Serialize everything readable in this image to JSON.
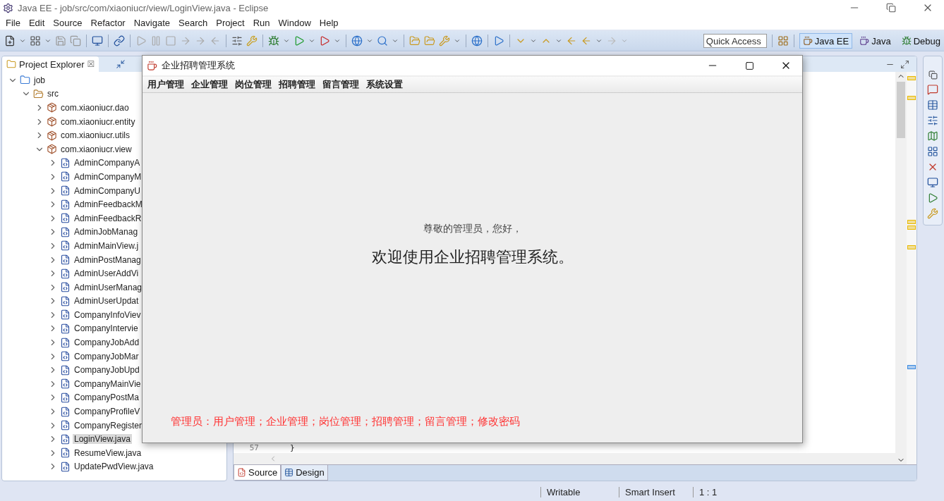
{
  "window": {
    "title": "Java EE - job/src/com/xiaoniucr/view/LoginView.java - Eclipse"
  },
  "menu": [
    "File",
    "Edit",
    "Source",
    "Refactor",
    "Navigate",
    "Search",
    "Project",
    "Run",
    "Window",
    "Help"
  ],
  "quick_access": {
    "placeholder": "Quick Access"
  },
  "perspectives": [
    {
      "label": "Java EE",
      "selected": true
    },
    {
      "label": "Java",
      "selected": false
    },
    {
      "label": "Debug",
      "selected": false
    }
  ],
  "explorer": {
    "title": "Project Explorer",
    "close": "☒",
    "tree": [
      {
        "label": "job",
        "kind": "project",
        "expanded": true,
        "selected": false,
        "children": [
          {
            "label": "src",
            "kind": "folder",
            "expanded": true,
            "selected": false,
            "children": [
              {
                "label": "com.xiaoniucr.dao",
                "kind": "package",
                "expanded": false,
                "selected": false
              },
              {
                "label": "com.xiaoniucr.entity",
                "kind": "package",
                "expanded": false,
                "selected": false
              },
              {
                "label": "com.xiaoniucr.utils",
                "kind": "package",
                "expanded": false,
                "selected": false
              },
              {
                "label": "com.xiaoniucr.view",
                "kind": "package",
                "expanded": true,
                "selected": false,
                "children": [
                  {
                    "label": "AdminCompanyA",
                    "kind": "file",
                    "expanded": false,
                    "selected": false
                  },
                  {
                    "label": "AdminCompanyM",
                    "kind": "file",
                    "expanded": false,
                    "selected": false
                  },
                  {
                    "label": "AdminCompanyU",
                    "kind": "file",
                    "expanded": false,
                    "selected": false
                  },
                  {
                    "label": "AdminFeedbackM",
                    "kind": "file",
                    "expanded": false,
                    "selected": false
                  },
                  {
                    "label": "AdminFeedbackR",
                    "kind": "file",
                    "expanded": false,
                    "selected": false
                  },
                  {
                    "label": "AdminJobManag",
                    "kind": "file",
                    "expanded": false,
                    "selected": false
                  },
                  {
                    "label": "AdminMainView.j",
                    "kind": "file",
                    "expanded": false,
                    "selected": false
                  },
                  {
                    "label": "AdminPostManag",
                    "kind": "file",
                    "expanded": false,
                    "selected": false
                  },
                  {
                    "label": "AdminUserAddVi",
                    "kind": "file",
                    "expanded": false,
                    "selected": false
                  },
                  {
                    "label": "AdminUserManag",
                    "kind": "file",
                    "expanded": false,
                    "selected": false
                  },
                  {
                    "label": "AdminUserUpdat",
                    "kind": "file",
                    "expanded": false,
                    "selected": false
                  },
                  {
                    "label": "CompanyInfoViev",
                    "kind": "file",
                    "expanded": false,
                    "selected": false
                  },
                  {
                    "label": "CompanyIntervie",
                    "kind": "file",
                    "expanded": false,
                    "selected": false
                  },
                  {
                    "label": "CompanyJobAdd",
                    "kind": "file",
                    "expanded": false,
                    "selected": false
                  },
                  {
                    "label": "CompanyJobMar",
                    "kind": "file",
                    "expanded": false,
                    "selected": false
                  },
                  {
                    "label": "CompanyJobUpd",
                    "kind": "file",
                    "expanded": false,
                    "selected": false
                  },
                  {
                    "label": "CompanyMainVie",
                    "kind": "file",
                    "expanded": false,
                    "selected": false
                  },
                  {
                    "label": "CompanyPostMa",
                    "kind": "file",
                    "expanded": false,
                    "selected": false
                  },
                  {
                    "label": "CompanyProfileV",
                    "kind": "file",
                    "expanded": false,
                    "selected": false
                  },
                  {
                    "label": "CompanyRegister",
                    "kind": "file",
                    "expanded": false,
                    "selected": false
                  },
                  {
                    "label": "LoginView.java",
                    "kind": "file",
                    "expanded": false,
                    "selected": true
                  },
                  {
                    "label": "ResumeView.java",
                    "kind": "file",
                    "expanded": false,
                    "selected": false
                  },
                  {
                    "label": "UpdatePwdView.java",
                    "kind": "file",
                    "expanded": false,
                    "selected": false
                  }
                ]
              }
            ]
          }
        ]
      }
    ]
  },
  "editor": {
    "lines": [
      {
        "number": "57",
        "code": "}"
      }
    ],
    "tabs": [
      {
        "label": "Source",
        "selected": true
      },
      {
        "label": "Design",
        "selected": false
      }
    ]
  },
  "status_bar": [
    "Writable",
    "Smart Insert",
    "1 : 1"
  ],
  "dialog": {
    "title": "企业招聘管理系统",
    "menu": [
      "用户管理",
      "企业管理",
      "岗位管理",
      "招聘管理",
      "留言管理",
      "系统设置"
    ],
    "greeting": "尊敬的管理员，您好，",
    "headline": "欢迎使用企业招聘管理系统。",
    "footer": "管理员：用户管理；企业管理；岗位管理；招聘管理；留言管理；修改密码"
  }
}
